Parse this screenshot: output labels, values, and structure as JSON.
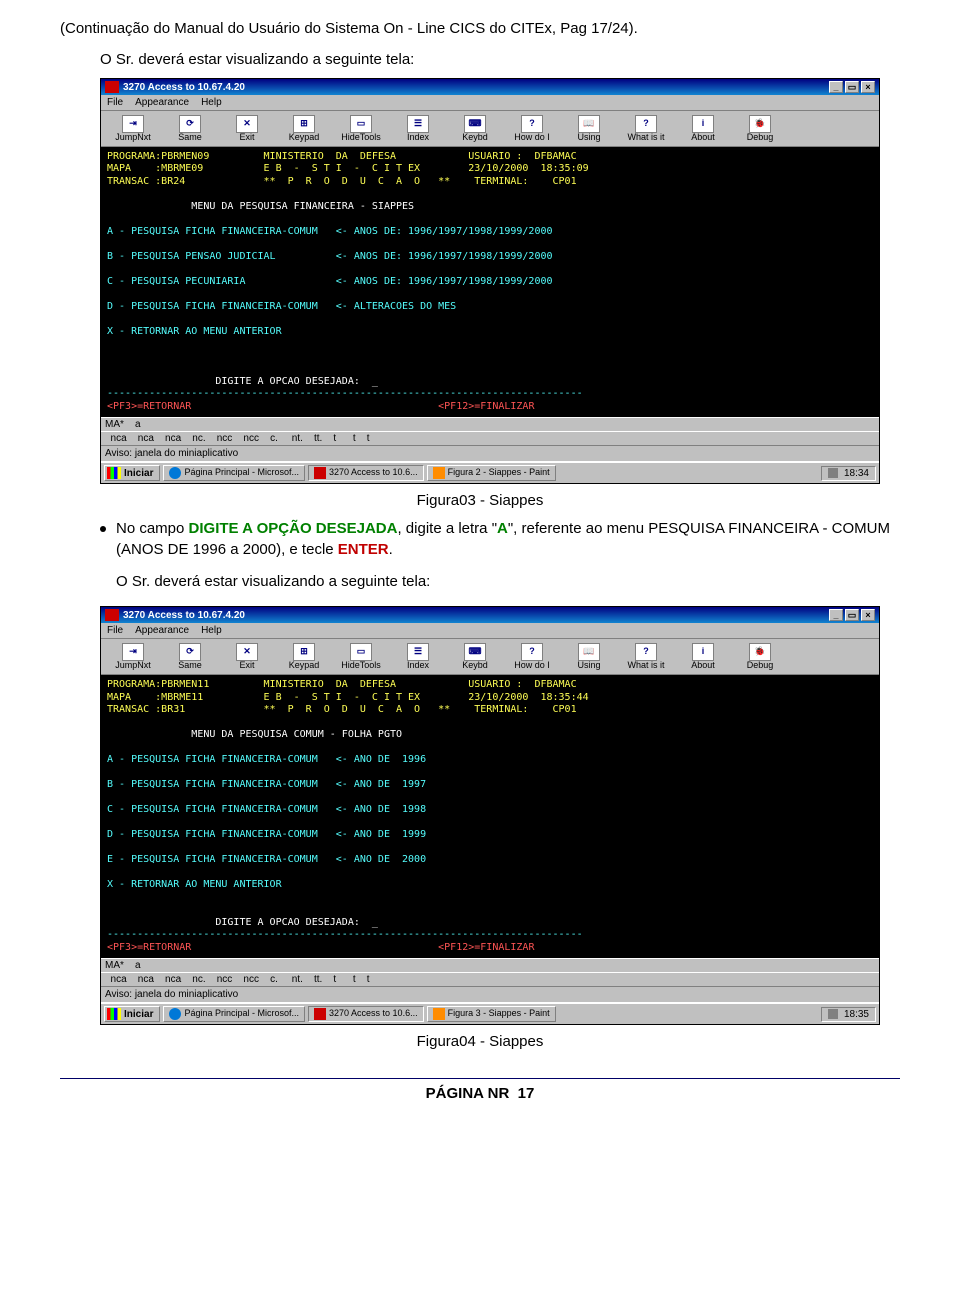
{
  "page": {
    "header": "(Continuação do Manual do Usuário do Sistema On - Line CICS do CITEx, Pag 17/24).",
    "intro1": "O Sr. deverá estar visualizando a seguinte tela:",
    "caption1": "Figura03 - Siappes",
    "bullet_pre": "No campo ",
    "bullet_g1": "DIGITE A OPÇÃO DESEJADA",
    "bullet_mid1": ", digite a letra \"",
    "bullet_a": "A",
    "bullet_mid2": "\", referente ao menu PESQUISA FINANCEIRA - COMUM (ANOS DE 1996 a 2000), e tecle ",
    "bullet_enter": "ENTER",
    "bullet_end": ".",
    "intro2": "O Sr. deverá estar visualizando a seguinte tela:",
    "caption2": "Figura04 - Siappes",
    "footer_label": "PÁGINA NR",
    "footer_num": "17"
  },
  "emu_common": {
    "menubar": [
      "File",
      "Appearance",
      "Help"
    ],
    "toolbar": [
      "JumpNxt",
      "Same",
      "Exit",
      "Keypad",
      "HideTools",
      "Index",
      "Keybd",
      "How do I",
      "Using",
      "What is it",
      "About",
      "Debug"
    ],
    "winbtns": {
      "min": "_",
      "restore": "▭",
      "close": "×"
    },
    "start": "Iniciar",
    "taskbtn1": "Página Principal - Microsof...",
    "taskbtn2": "3270 Access to 10.6...",
    "aviso": "Aviso: janela do miniaplicativo",
    "ma": "MA*    a",
    "statuscells": "  nca    nca    nca    nc.    ncc    ncc    c.     nt.    tt.    t      t    t",
    "pf3": "<PF3>=RETORNAR",
    "pf12": "<PF12>=FINALIZAR"
  },
  "shot1": {
    "title": "3270 Access to 10.67.4.20",
    "taskbtn3": "Figura 2 - Siappes - Paint",
    "clock": "18:34",
    "header1": "PROGRAMA:PBRMEN09         MINISTERIO  DA  DEFESA            USUARIO :  DFBAMAC",
    "header2": "MAPA    :MBRME09          E B  -  S T I  -  C I T EX        23/10/2000  18:35:09",
    "header3": "TRANSAC :BR24             **  P  R  O  D  U  C  A  O   **    TERMINAL:    CP01",
    "menu_title": "MENU DA PESQUISA FINANCEIRA - SIAPPES",
    "lines": [
      "A - PESQUISA FICHA FINANCEIRA-COMUM   <- ANOS DE: 1996/1997/1998/1999/2000",
      "B - PESQUISA PENSAO JUDICIAL          <- ANOS DE: 1996/1997/1998/1999/2000",
      "C - PESQUISA PECUNIARIA               <- ANOS DE: 1996/1997/1998/1999/2000",
      "D - PESQUISA FICHA FINANCEIRA-COMUM   <- ALTERACOES DO MES",
      "X - RETORNAR AO MENU ANTERIOR"
    ],
    "prompt": "DIGITE A OPCAO DESEJADA:  _"
  },
  "shot2": {
    "title": "3270 Access to 10.67.4.20",
    "taskbtn3": "Figura 3 - Siappes - Paint",
    "clock": "18:35",
    "header1": "PROGRAMA:PBRMEN11         MINISTERIO  DA  DEFESA            USUARIO :  DFBAMAC",
    "header2": "MAPA    :MBRME11          E B  -  S T I  -  C I T EX        23/10/2000  18:35:44",
    "header3": "TRANSAC :BR31             **  P  R  O  D  U  C  A  O   **    TERMINAL:    CP01",
    "menu_title": "MENU DA PESQUISA COMUM - FOLHA PGTO",
    "lines": [
      "A - PESQUISA FICHA FINANCEIRA-COMUM   <- ANO DE  1996",
      "B - PESQUISA FICHA FINANCEIRA-COMUM   <- ANO DE  1997",
      "C - PESQUISA FICHA FINANCEIRA-COMUM   <- ANO DE  1998",
      "D - PESQUISA FICHA FINANCEIRA-COMUM   <- ANO DE  1999",
      "E - PESQUISA FICHA FINANCEIRA-COMUM   <- ANO DE  2000",
      "X - RETORNAR AO MENU ANTERIOR"
    ],
    "prompt": "DIGITE A OPCAO DESEJADA:  _"
  }
}
